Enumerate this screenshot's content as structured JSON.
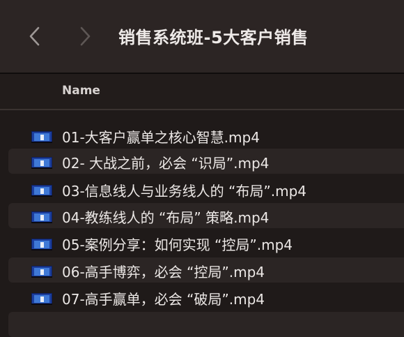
{
  "window": {
    "title": "销售系统班-5大客户销售"
  },
  "toolbar": {
    "back_icon": "chevron-left-icon",
    "forward_icon": "chevron-right-icon"
  },
  "columns": {
    "name": "Name"
  },
  "files": [
    {
      "name": "01-大客户赢单之核心智慧.mp4",
      "icon": "video-thumbnail-icon"
    },
    {
      "name": "02- 大战之前，必会 “识局”.mp4",
      "icon": "video-thumbnail-icon"
    },
    {
      "name": "03-信息线人与业务线人的 “布局”.mp4",
      "icon": "video-thumbnail-icon"
    },
    {
      "name": "04-教练线人的 “布局” 策略.mp4",
      "icon": "video-thumbnail-icon"
    },
    {
      "name": "05-案例分享：如何实现 “控局”.mp4",
      "icon": "video-thumbnail-icon"
    },
    {
      "name": "06-高手博弈，必会 “控局”.mp4",
      "icon": "video-thumbnail-icon"
    },
    {
      "name": "07-高手赢单，必会 “破局”.mp4",
      "icon": "video-thumbnail-icon"
    }
  ],
  "colors": {
    "background": "#1f1a19",
    "toolbar": "#2c2524",
    "row_stripe": "#2b2524",
    "text": "#ece8e6"
  }
}
